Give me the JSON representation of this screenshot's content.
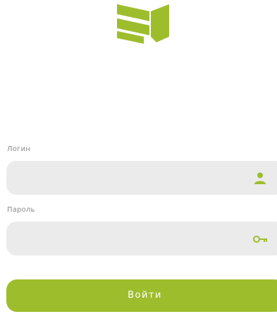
{
  "login": {
    "label": "Логин",
    "value": "",
    "icon": "user-icon"
  },
  "password": {
    "label": "Пароль",
    "value": "",
    "icon": "key-icon"
  },
  "submit": {
    "label": "Войти"
  },
  "colors": {
    "accent": "#9ebd2d",
    "field_background": "#ebebeb",
    "label": "#8a8a8a"
  }
}
